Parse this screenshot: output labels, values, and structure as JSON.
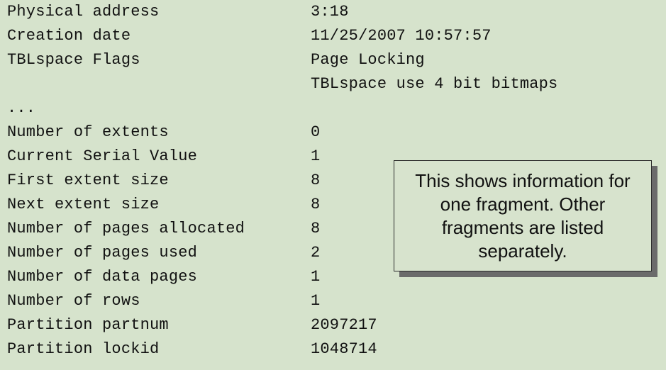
{
  "rows": [
    {
      "label": "Physical address",
      "value": "3:18"
    },
    {
      "label": "Creation date",
      "value": "11/25/2007 10:57:57"
    },
    {
      "label": "TBLspace Flags",
      "value": "Page Locking"
    },
    {
      "label": "",
      "value": "TBLspace use 4 bit bitmaps"
    },
    {
      "label": "...",
      "value": ""
    },
    {
      "label": "Number of extents",
      "value": "0"
    },
    {
      "label": "Current Serial Value",
      "value": "1"
    },
    {
      "label": "First extent size",
      "value": "8"
    },
    {
      "label": "Next extent size",
      "value": "8"
    },
    {
      "label": "Number of pages allocated",
      "value": "8"
    },
    {
      "label": "Number of pages used",
      "value": "2"
    },
    {
      "label": "Number of data pages",
      "value": "1"
    },
    {
      "label": "Number of rows",
      "value": "1"
    },
    {
      "label": "Partition partnum",
      "value": "2097217"
    },
    {
      "label": "Partition lockid",
      "value": "1048714"
    }
  ],
  "callout": {
    "text": "This shows information for one fragment. Other fragments are listed separately."
  }
}
